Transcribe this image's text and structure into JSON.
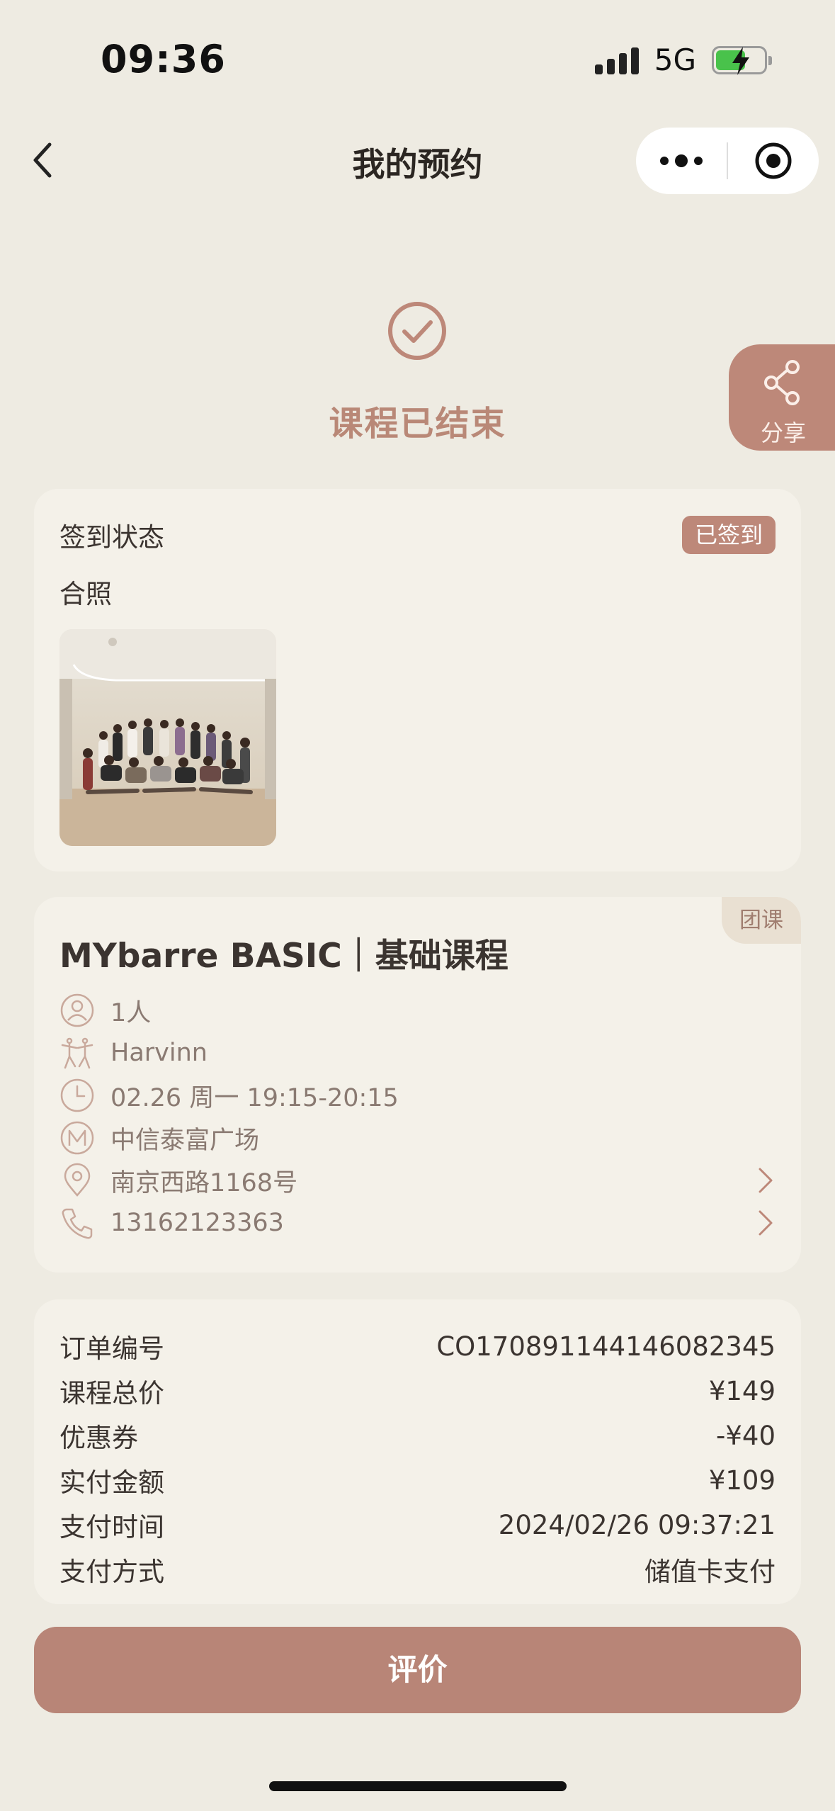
{
  "status_bar": {
    "time": "09:36",
    "network": "5G"
  },
  "nav": {
    "title": "我的预约"
  },
  "hero": {
    "status_text": "课程已结束"
  },
  "share": {
    "label": "分享"
  },
  "checkin": {
    "label": "签到状态",
    "badge": "已签到",
    "photo_label": "合照"
  },
  "course": {
    "tag": "团课",
    "title": "MYbarre BASIC｜基础课程",
    "rows": [
      {
        "icon": "person-icon",
        "text": "1人"
      },
      {
        "icon": "dancer-icon",
        "text": "Harvinn"
      },
      {
        "icon": "clock-icon",
        "text": "02.26 周一 19:15-20:15"
      },
      {
        "icon": "m-logo-icon",
        "text": "中信泰富广场"
      },
      {
        "icon": "location-pin-icon",
        "text": "南京西路1168号"
      },
      {
        "icon": "phone-icon",
        "text": "13162123363"
      }
    ]
  },
  "order": {
    "rows": [
      {
        "label": "订单编号",
        "value": "CO17089114414608234​5"
      },
      {
        "label": "课程总价",
        "value": "¥149"
      },
      {
        "label": "优惠券",
        "value": "-¥40"
      },
      {
        "label": "实付金额",
        "value": "¥109"
      },
      {
        "label": "支付时间",
        "value": "2024/02/26 09:37:21"
      },
      {
        "label": "支付方式",
        "value": "储值卡支付"
      }
    ]
  },
  "actions": {
    "evaluate": "评价"
  },
  "colors": {
    "accent": "#bd8879",
    "background": "#eeebe2",
    "card": "#f4f1e9"
  }
}
